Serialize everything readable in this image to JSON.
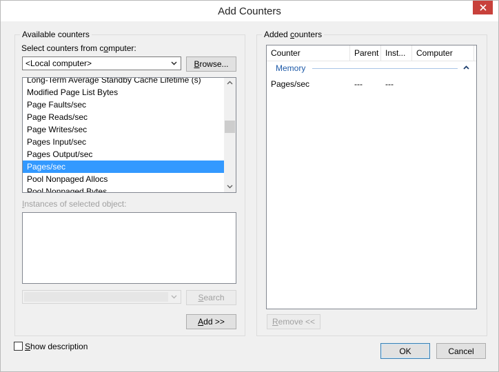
{
  "window": {
    "title": "Add Counters"
  },
  "available": {
    "group_label": "Available counters",
    "select_label_pre": "Select counters from c",
    "select_label_u": "o",
    "select_label_post": "mputer:",
    "computer_value": "<Local computer>",
    "browse_u": "B",
    "browse_rest": "rowse...",
    "counters": [
      "Long-Term Average Standby Cache Lifetime (s)",
      "Modified Page List Bytes",
      "Page Faults/sec",
      "Page Reads/sec",
      "Page Writes/sec",
      "Pages Input/sec",
      "Pages Output/sec",
      "Pages/sec",
      "Pool Nonpaged Allocs",
      "Pool Nonpaged Bytes"
    ],
    "selected_counter": "Pages/sec",
    "instances_label_u": "I",
    "instances_label_rest": "nstances of selected object:",
    "search_u": "S",
    "search_rest": "earch",
    "add_u": "A",
    "add_rest": "dd >>"
  },
  "added": {
    "group_label_pre": "Added ",
    "group_label_u": "c",
    "group_label_post": "ounters",
    "columns": [
      "Counter",
      "Parent",
      "Inst...",
      "Computer"
    ],
    "group_name": "Memory",
    "rows": [
      {
        "counter": "Pages/sec",
        "parent": "---",
        "instance": "---",
        "computer": ""
      }
    ],
    "remove_u": "R",
    "remove_rest": "emove <<"
  },
  "footer": {
    "show_description_u": "S",
    "show_description_rest": "how description",
    "show_description_checked": false,
    "ok_label": "OK",
    "cancel_label": "Cancel"
  }
}
